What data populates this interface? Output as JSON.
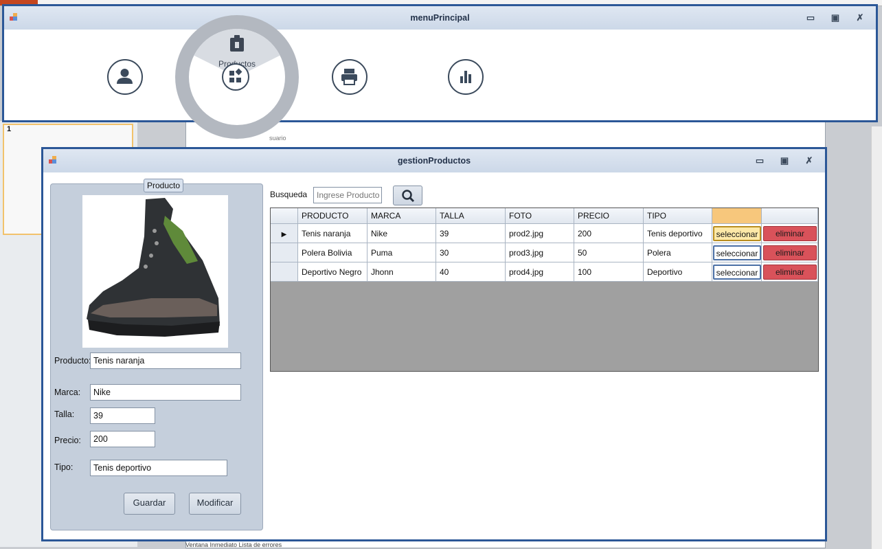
{
  "menu_window": {
    "title": "menuPrincipal",
    "active_item_label": "Productos",
    "items": [
      {
        "name": "usuario",
        "icon": "person-icon"
      },
      {
        "name": "productos",
        "icon": "products-icon"
      },
      {
        "name": "imprimir",
        "icon": "printer-icon"
      },
      {
        "name": "reportes",
        "icon": "bar-chart-icon"
      }
    ]
  },
  "background": {
    "slide_number": "1",
    "ghost_label": "suario",
    "status_text": "Ventana Inmediato   Lista de errores"
  },
  "gestion_window": {
    "title": "gestionProductos",
    "group_title": "Producto",
    "labels": {
      "producto": "Producto:",
      "marca": "Marca:",
      "talla": "Talla:",
      "precio": "Precio:",
      "tipo": "Tipo:"
    },
    "values": {
      "producto": "Tenis naranja",
      "marca": "Nike",
      "talla": "39",
      "precio": "200",
      "tipo": "Tenis deportivo"
    },
    "buttons": {
      "guardar": "Guardar",
      "modificar": "Modificar"
    },
    "search": {
      "label": "Busqueda",
      "placeholder": "Ingrese Producto"
    },
    "grid": {
      "headers": [
        "PRODUCTO",
        "MARCA",
        "TALLA",
        "FOTO",
        "PRECIO",
        "TIPO"
      ],
      "rows": [
        {
          "producto": "Tenis naranja",
          "marca": "Nike",
          "talla": "39",
          "foto": "prod2.jpg",
          "precio": "200",
          "tipo": "Tenis deportivo",
          "select_label": "seleccionar",
          "delete_label": "eliminar"
        },
        {
          "producto": "Polera Bolivia",
          "marca": "Puma",
          "talla": "30",
          "foto": "prod3.jpg",
          "precio": "50",
          "tipo": "Polera",
          "select_label": "seleccionar",
          "delete_label": "eliminar"
        },
        {
          "producto": "Deportivo Negro",
          "marca": "Jhonn",
          "talla": "40",
          "foto": "prod4.jpg",
          "precio": "100",
          "tipo": "Deportivo",
          "select_label": "seleccionar",
          "delete_label": "eliminar"
        }
      ]
    }
  },
  "colors": {
    "window_border": "#2b5797",
    "titlebar": "#d6dfeb",
    "delete_button": "#d9525a",
    "select_highlight": "#fde9a8"
  }
}
